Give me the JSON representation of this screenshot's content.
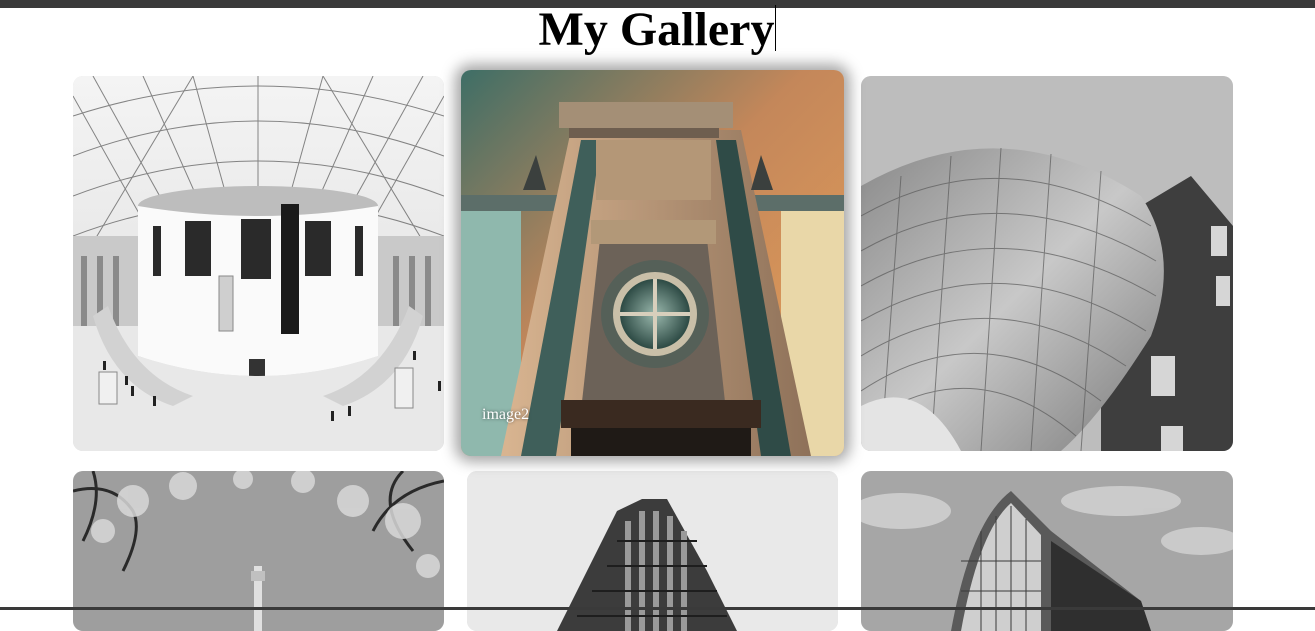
{
  "page": {
    "title": "My Gallery"
  },
  "gallery": {
    "images": [
      {
        "caption": "",
        "alt": "domed atrium"
      },
      {
        "caption": "image2",
        "alt": "building facade with round window"
      },
      {
        "caption": "",
        "alt": "curved metal facade"
      },
      {
        "caption": "",
        "alt": "tower through branches"
      },
      {
        "caption": "",
        "alt": "high-rise building"
      },
      {
        "caption": "",
        "alt": "glass building"
      }
    ]
  }
}
